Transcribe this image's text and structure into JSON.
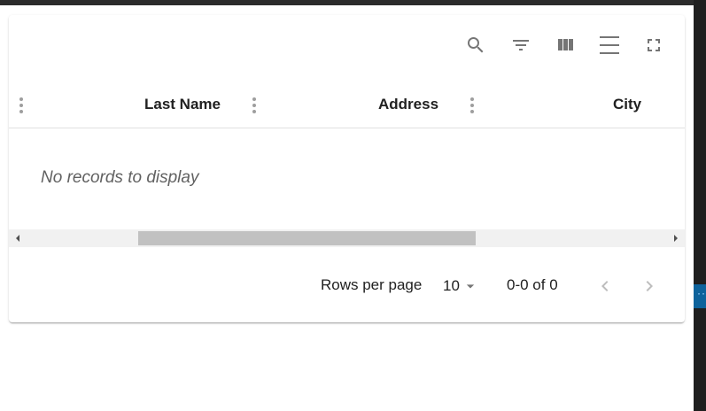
{
  "toolbar": {
    "icons": [
      "search-icon",
      "filter-list-icon",
      "view-column-icon",
      "density-icon",
      "fullscreen-icon"
    ]
  },
  "table": {
    "columns": [
      {
        "header": "Last Name"
      },
      {
        "header": "Address"
      },
      {
        "header": "City"
      }
    ],
    "empty_message": "No records to display"
  },
  "pagination": {
    "rows_per_page_label": "Rows per page",
    "rows_per_page_value": "10",
    "range_text": "0-0 of 0"
  },
  "colors": {
    "icon": "#757575",
    "disabled_icon": "#bdbdbd",
    "scroll_track": "#f1f1f1",
    "scroll_thumb": "#c1c1c1",
    "accent_strip": "#0e639c"
  }
}
